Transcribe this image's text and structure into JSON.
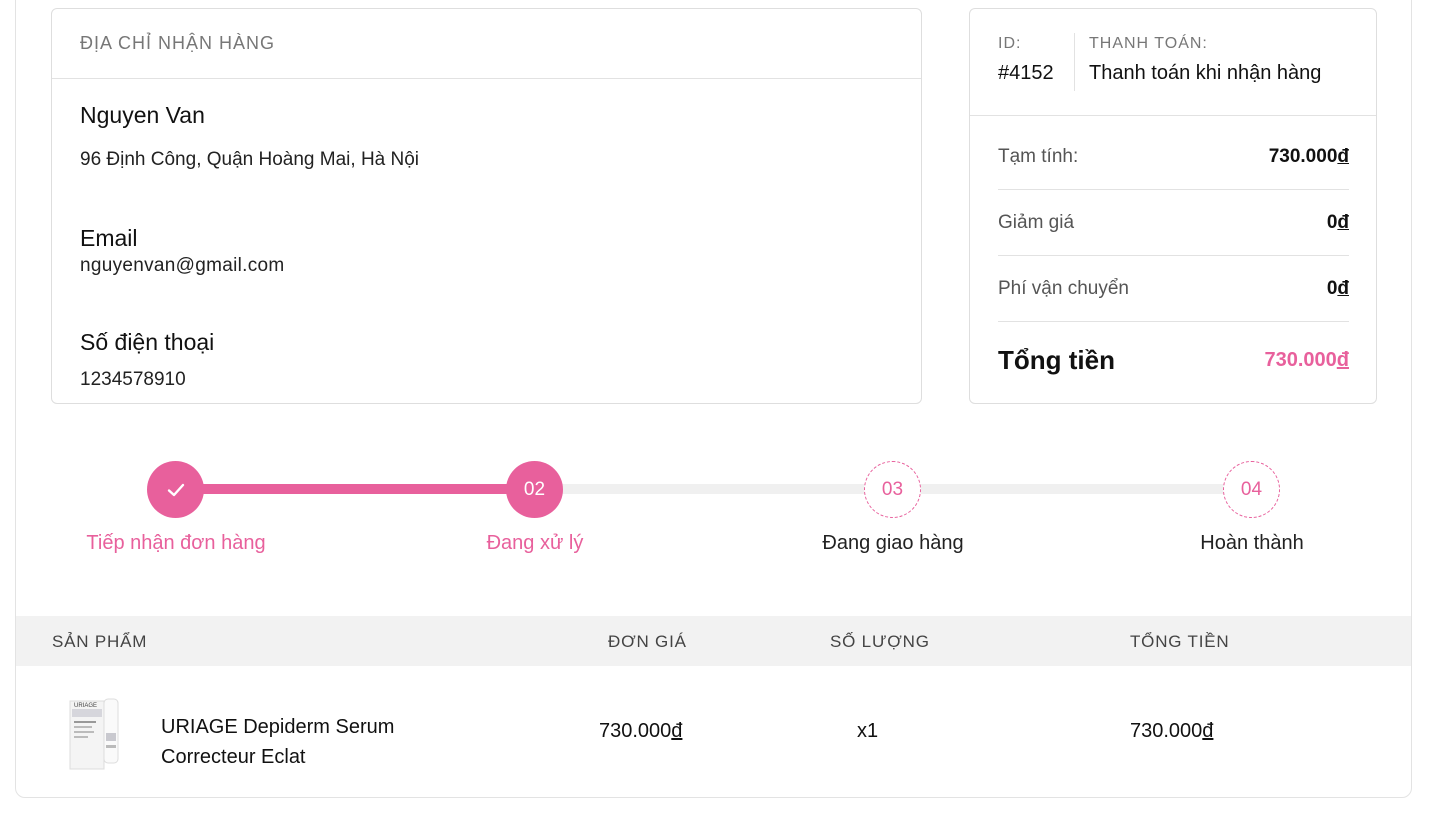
{
  "address": {
    "heading": "ĐỊA CHỈ NHẬN HÀNG",
    "name": "Nguyen Van",
    "line": "96 Định Công, Quận Hoàng Mai, Hà Nội",
    "email_label": "Email",
    "email": "nguyenvan@gmail.com",
    "phone_label": "Số điện thoại",
    "phone": "1234578910"
  },
  "summary": {
    "id_label": "ID:",
    "id": "#4152",
    "payment_label": "THANH TOÁN:",
    "payment": "Thanh toán khi nhận hàng",
    "rows": [
      {
        "label": "Tạm tính:",
        "amount": "730.000",
        "currency": "đ"
      },
      {
        "label": "Giảm giá",
        "amount": "0",
        "currency": "đ"
      },
      {
        "label": "Phí vận chuyển",
        "amount": "0",
        "currency": "đ"
      }
    ],
    "total_label": "Tổng tiền",
    "total_amount": "730.000",
    "total_currency": "đ"
  },
  "progress": {
    "steps": [
      {
        "number": "",
        "label": "Tiếp nhận đơn hàng",
        "state": "done"
      },
      {
        "number": "02",
        "label": "Đang xử lý",
        "state": "current"
      },
      {
        "number": "03",
        "label": "Đang giao hàng",
        "state": "pending"
      },
      {
        "number": "04",
        "label": "Hoàn thành",
        "state": "pending"
      }
    ],
    "accent_color": "#e8609c"
  },
  "table": {
    "headers": [
      "SẢN PHẨM",
      "ĐƠN GIÁ",
      "SỐ LƯỢNG",
      "TỔNG TIỀN"
    ],
    "rows": [
      {
        "product_line1": "URIAGE Depiderm Serum",
        "product_line2": "Correcteur Eclat",
        "brand_on_image": "URIAGE",
        "unit_price": "730.000",
        "quantity": "x1",
        "total": "730.000",
        "currency": "đ"
      }
    ]
  }
}
